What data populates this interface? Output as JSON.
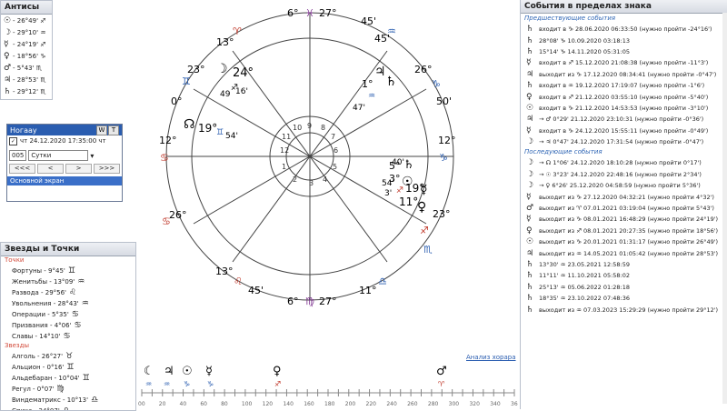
{
  "antis": {
    "title": "Антисы",
    "rows": [
      {
        "glyph": "☉",
        "text": "- 26°49' ♐"
      },
      {
        "glyph": "☽",
        "text": "- 29°10' ♒"
      },
      {
        "glyph": "☿",
        "text": "- 24°19' ♐"
      },
      {
        "glyph": "♀",
        "text": "- 18°56' ♑"
      },
      {
        "glyph": "♂",
        "text": "- 5°43' ♏"
      },
      {
        "glyph": "♃",
        "text": "- 28°53' ♏"
      },
      {
        "glyph": "♄",
        "text": "- 29°12' ♏"
      }
    ]
  },
  "nogaya": {
    "title": "Ногаау",
    "btn_w": "W",
    "btn_t": "T",
    "datetime": "чт 24.12.2020 17:35:00 чт",
    "spin_value": "005",
    "period": "Сутки",
    "nav": [
      "<<<",
      "<",
      ">",
      ">>>"
    ],
    "main_screen": "Основной экран"
  },
  "stars": {
    "title": "Звезды и Точки",
    "points_label": "Точки",
    "points": [
      {
        "text": "Фортуны - 9°45'",
        "glyph": "♊"
      },
      {
        "text": "Женитьбы - 13°09'",
        "glyph": "♒"
      },
      {
        "text": "Развода - 29°56'",
        "glyph": "♌"
      },
      {
        "text": "Увольнения - 28°43'",
        "glyph": "♒"
      },
      {
        "text": "Операции - 5°35'",
        "glyph": "♋"
      },
      {
        "text": "Призвания - 4°06'",
        "glyph": "♋"
      },
      {
        "text": "Славы - 14°10'",
        "glyph": "♋"
      }
    ],
    "stars_label": "Звезды",
    "stars": [
      {
        "text": "Алголь - 26°27'",
        "glyph": "♉"
      },
      {
        "text": "Альцион - 0°16'",
        "glyph": "♊"
      },
      {
        "text": "Альдебаран - 10°04'",
        "glyph": "♊"
      },
      {
        "text": "Регул - 0°07'",
        "glyph": "♍"
      },
      {
        "text": "Виндематрикс - 10°13'",
        "glyph": "♎"
      },
      {
        "text": "Спика - 24°07'",
        "glyph": "♎"
      }
    ]
  },
  "chart": {
    "signs_top": {
      "l": "6°",
      "r": "27°",
      "glyph": "♓"
    },
    "signs_bottom": {
      "l": "6°",
      "r": "27°",
      "glyph": "♍"
    },
    "cusp_labels": [
      "13°",
      "23°",
      "0°",
      "12°",
      "26°",
      "13°",
      "11°",
      "23°",
      "50'",
      "12°",
      "26°",
      "45'",
      "45'",
      "54'",
      "50'",
      "0°"
    ],
    "house_numbers": [
      "1",
      "2",
      "3",
      "4",
      "5",
      "6",
      "7",
      "8",
      "9",
      "10",
      "11",
      "12"
    ],
    "planet_text": {
      "moon": "24°",
      "moon_m": "16'",
      "moon_m2": "49",
      "node": "19°",
      "node_m": "54'",
      "jup": "1°",
      "jup_m": "47'",
      "sat": "5°",
      "sat_m": "40'",
      "sun": "3°",
      "sun_m": "54'",
      "merc": "19°",
      "merc_m": "3'",
      "ven": "11°",
      "ven_m": "38'",
      "mars_small": "0°"
    }
  },
  "timeline": {
    "link": "Анализ хорара",
    "ticks": [
      "00",
      "10",
      "20",
      "30",
      "40",
      "50",
      "60",
      "70",
      "80",
      "90",
      "100",
      "110",
      "120",
      "130",
      "140",
      "150",
      "160",
      "170",
      "180",
      "190",
      "200",
      "210",
      "220",
      "230",
      "240",
      "250",
      "260",
      "270",
      "280",
      "290",
      "300",
      "310",
      "320",
      "330",
      "340",
      "350",
      "360"
    ]
  },
  "events": {
    "title": "События в пределах знака",
    "prev_label": "Предшествующие события",
    "prev": [
      {
        "g": "♄",
        "t": "входит в ♑ 28.06.2020 06:33:50 (нужно пройти -24°16')"
      },
      {
        "g": "♄",
        "t": "28°08' ♑ 10.09.2020 03:18:13"
      },
      {
        "g": "♄",
        "t": "15°14' ♑ 14.11.2020 05:31:05"
      },
      {
        "g": "☿",
        "t": "входит в ♐ 15.12.2020 21:08:38 (нужно пройти -11°3')"
      },
      {
        "g": "♃",
        "t": "выходит из ♑ 17.12.2020 08:34:41 (нужно пройти -0°47')"
      },
      {
        "g": "♄",
        "t": "входит в ♒ 19.12.2020 17:19:07 (нужно пройти -1°6')"
      },
      {
        "g": "♀",
        "t": "входит в ♐ 21.12.2020 03:55:10 (нужно пройти -5°40')"
      },
      {
        "g": "☉",
        "t": "входит в ♑ 21.12.2020 14:53:53 (нужно пройти -3°10')"
      },
      {
        "g": "♃",
        "t": "→ ♂ 0°29' 21.12.2020 23:10:31 (нужно пройти -0°36')"
      },
      {
        "g": "☿",
        "t": "входит в ♑ 24.12.2020 15:55:11 (нужно пройти -0°49')"
      },
      {
        "g": "☽",
        "t": "→ ♃ 0°47' 24.12.2020 17:31:54 (нужно пройти -0°47')"
      }
    ],
    "next_label": "Последующие события",
    "next": [
      {
        "g": "☽",
        "t": "→ ☊ 1°06' 24.12.2020 18:10:28 (нужно пройти 0°17')"
      },
      {
        "g": "☽",
        "t": "→ ☉ 3°23' 24.12.2020 22:48:16 (нужно пройти 2°34')"
      },
      {
        "g": "☽",
        "t": "→ ♀ 6°26' 25.12.2020 04:58:59 (нужно пройти 5°36')"
      },
      {
        "g": "☿",
        "t": "выходит из ♑ 27.12.2020 04:32:21 (нужно пройти 4°32')"
      },
      {
        "g": "♂",
        "t": "выходит из ♈ 07.01.2021 03:19:04 (нужно пройти 5°43')"
      },
      {
        "g": "☿",
        "t": "выходит из ♑ 08.01.2021 16:48:29 (нужно пройти 24°19')"
      },
      {
        "g": "♀",
        "t": "выходит из ♐ 08.01.2021 20:27:35 (нужно пройти 18°56')"
      },
      {
        "g": "☉",
        "t": "выходит из ♑ 20.01.2021 01:31:17 (нужно пройти 26°49')"
      },
      {
        "g": "♃",
        "t": "выходит из ♒ 14.05.2021 01:05:42 (нужно пройти 28°53')"
      },
      {
        "g": "♄",
        "t": "13°30' ♒ 23.05.2021 12:58:59"
      },
      {
        "g": "♄",
        "t": "11°11' ♒ 11.10.2021 05:58:02"
      },
      {
        "g": "♄",
        "t": "25°13' ♒ 05.06.2022 01:28:18"
      },
      {
        "g": "♄",
        "t": "18°35' ♒ 23.10.2022 07:48:36"
      },
      {
        "g": "♄",
        "t": "выходит из ♒ 07.03.2023 15:29:29 (нужно пройти 29°12')"
      }
    ]
  },
  "colors": {
    "accent": "#2a5db0",
    "red": "#c0392b"
  }
}
